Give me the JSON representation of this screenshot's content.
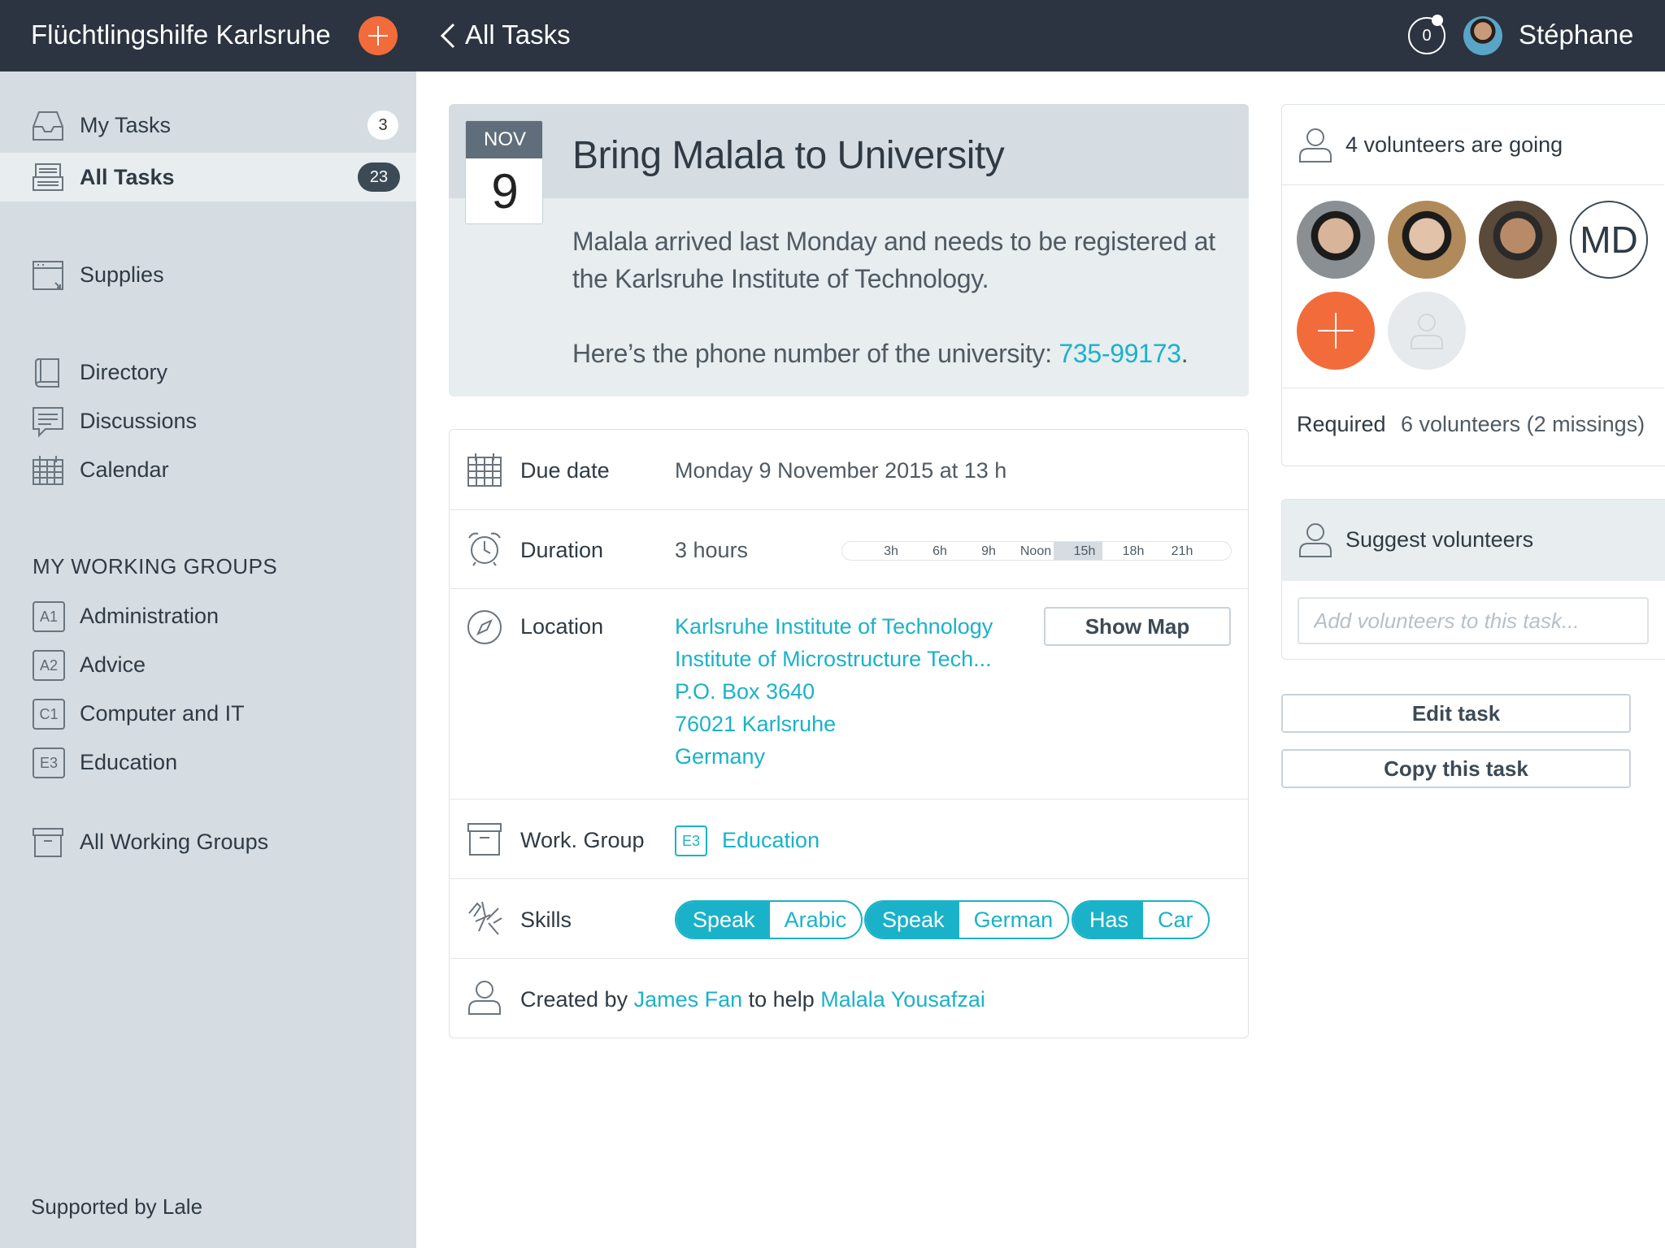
{
  "topbar": {
    "org_name": "Flüchtlingshilfe Karlsruhe",
    "nav_title": "All Tasks",
    "notification_count": "0",
    "user_name": "Stéphane"
  },
  "sidebar": {
    "items": [
      {
        "label": "My Tasks",
        "badge": "3",
        "icon": "inbox-icon"
      },
      {
        "label": "All Tasks",
        "badge": "23",
        "icon": "stack-icon"
      },
      {
        "label": "Supplies",
        "icon": "box-icon"
      },
      {
        "label": "Directory",
        "icon": "book-icon"
      },
      {
        "label": "Discussions",
        "icon": "chat-icon"
      },
      {
        "label": "Calendar",
        "icon": "calendar-icon"
      }
    ],
    "section_title": "MY WORKING GROUPS",
    "groups": [
      {
        "code": "A1",
        "label": "Administration"
      },
      {
        "code": "A2",
        "label": "Advice"
      },
      {
        "code": "C1",
        "label": "Computer and IT"
      },
      {
        "code": "E3",
        "label": "Education"
      }
    ],
    "all_groups": "All Working Groups",
    "footer": "Supported by Lale"
  },
  "task": {
    "month": "NOV",
    "day": "9",
    "title": "Bring Malala to University",
    "description": "Malala arrived last Monday and needs to be registered at the Karlsruhe Institute of Technology.",
    "phone_prefix": "Here’s the phone number of the university: ",
    "phone": "735-99173",
    "phone_suffix": "."
  },
  "details": {
    "due_label": "Due date",
    "due_value": "Monday 9 November 2015 at 13 h",
    "duration_label": "Duration",
    "duration_value": "3 hours",
    "timeline_ticks": [
      "3h",
      "6h",
      "9h",
      "Noon",
      "15h",
      "18h",
      "21h"
    ],
    "location_label": "Location",
    "address": [
      "Karlsruhe Institute of Technology",
      "Institute of Microstructure Tech...",
      "P.O. Box 3640",
      "76021 Karlsruhe",
      "Germany"
    ],
    "show_map": "Show Map",
    "group_label": "Work. Group",
    "group_code": "E3",
    "group_name": "Education",
    "skills_label": "Skills",
    "skills": [
      {
        "key": "Speak",
        "value": "Arabic"
      },
      {
        "key": "Speak",
        "value": "German"
      },
      {
        "key": "Has",
        "value": "Car"
      }
    ],
    "created_prefix": "Created by ",
    "creator": "James Fan",
    "created_mid": " to help ",
    "beneficiary": "Malala Yousafzai"
  },
  "volunteers": {
    "heading": "4 volunteers are going",
    "initials": "MD",
    "required_label": "Required",
    "required_value": "6 volunteers (2 missings)"
  },
  "suggest": {
    "title": "Suggest volunteers",
    "placeholder": "Add volunteers to this task..."
  },
  "actions": {
    "edit": "Edit task",
    "copy": "Copy this task"
  },
  "colors": {
    "topbar": "#2b3440",
    "sidebar": "#d5dde2",
    "accent": "#1ab2c9",
    "orange": "#f26b3a"
  }
}
